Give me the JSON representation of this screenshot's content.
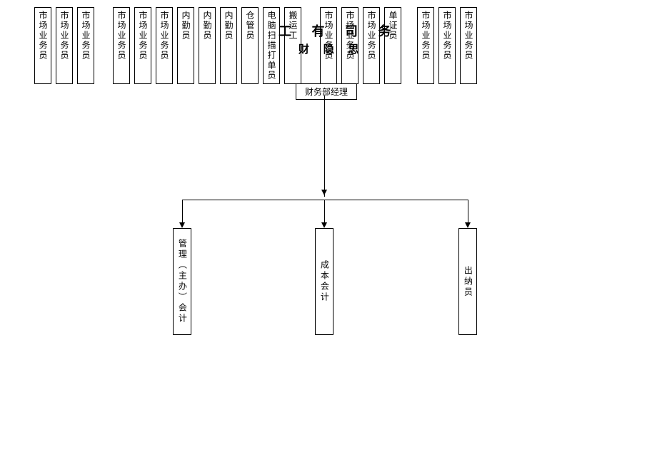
{
  "title": "工  有  司 务",
  "subtitle": "财  隐 思",
  "manager": "财务部经理",
  "top_boxes": [
    "市场业务员",
    "市场业务员",
    "市场业务员",
    "市场业务员",
    "市场业务员",
    "市场业务员",
    "内勤员",
    "内勤员",
    "内勤员",
    "仓管员",
    "电脑扫描打单员",
    "搬运工",
    "市场业务员",
    "市场业务员",
    "市场业务员",
    "单证员",
    "市场业务员",
    "市场业务员",
    "市场业务员"
  ],
  "bottom_boxes": [
    "管理（主办）会计",
    "成本会计",
    "出纳员"
  ]
}
